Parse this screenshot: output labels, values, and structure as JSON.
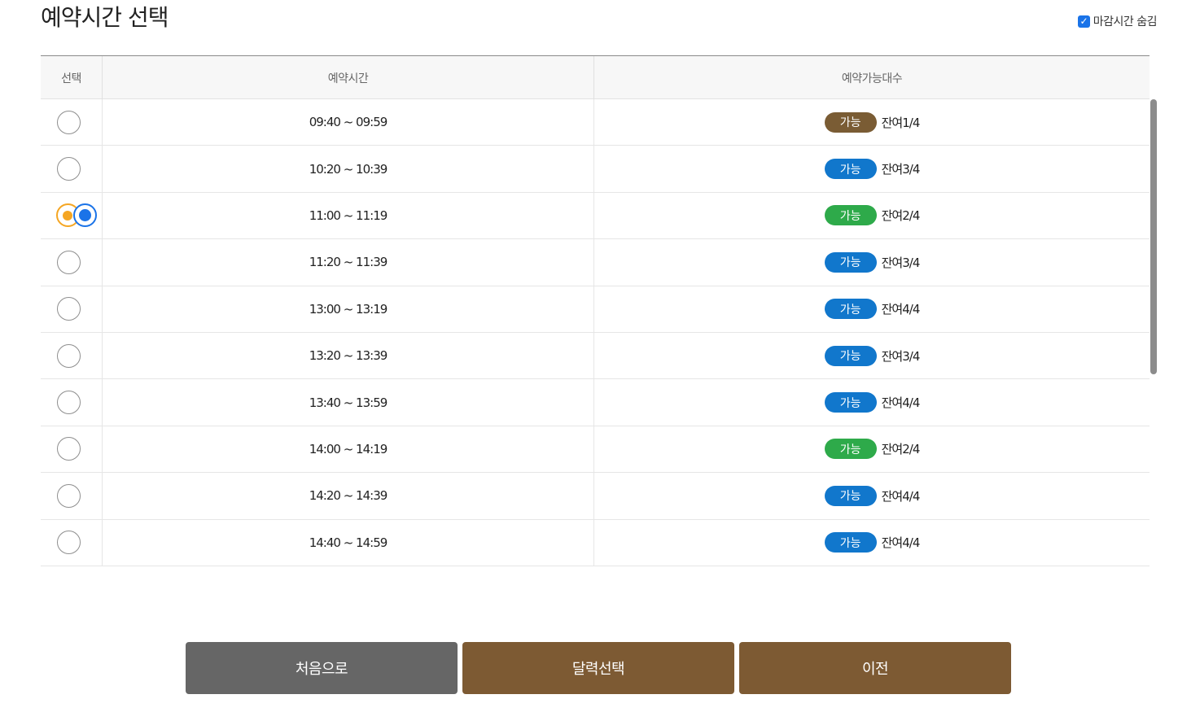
{
  "page_title": "예약시간 선택",
  "hide_closed": {
    "label": "마감시간 숨김",
    "checked": true
  },
  "table": {
    "headers": {
      "select": "선택",
      "time": "예약시간",
      "capacity": "예약가능대수"
    },
    "rows": [
      {
        "time": "09:40 ~ 09:59",
        "status": "가능",
        "status_color": "#7a5c34",
        "remain": "잔여1/4",
        "selected": false
      },
      {
        "time": "10:20 ~ 10:39",
        "status": "가능",
        "status_color": "#1177cc",
        "remain": "잔여3/4",
        "selected": false
      },
      {
        "time": "11:00 ~ 11:19",
        "status": "가능",
        "status_color": "#2eaa4a",
        "remain": "잔여2/4",
        "selected": true
      },
      {
        "time": "11:20 ~ 11:39",
        "status": "가능",
        "status_color": "#1177cc",
        "remain": "잔여3/4",
        "selected": false
      },
      {
        "time": "13:00 ~ 13:19",
        "status": "가능",
        "status_color": "#1177cc",
        "remain": "잔여4/4",
        "selected": false
      },
      {
        "time": "13:20 ~ 13:39",
        "status": "가능",
        "status_color": "#1177cc",
        "remain": "잔여3/4",
        "selected": false
      },
      {
        "time": "13:40 ~ 13:59",
        "status": "가능",
        "status_color": "#1177cc",
        "remain": "잔여4/4",
        "selected": false
      },
      {
        "time": "14:00 ~ 14:19",
        "status": "가능",
        "status_color": "#2eaa4a",
        "remain": "잔여2/4",
        "selected": false
      },
      {
        "time": "14:20 ~ 14:39",
        "status": "가능",
        "status_color": "#1177cc",
        "remain": "잔여4/4",
        "selected": false
      },
      {
        "time": "14:40 ~ 14:59",
        "status": "가능",
        "status_color": "#1177cc",
        "remain": "잔여4/4",
        "selected": false
      }
    ]
  },
  "buttons": {
    "first": {
      "label": "처음으로",
      "color": "#666666"
    },
    "calendar": {
      "label": "달력선택",
      "color": "#7d5a33"
    },
    "prev": {
      "label": "이전",
      "color": "#7d5a33"
    }
  }
}
